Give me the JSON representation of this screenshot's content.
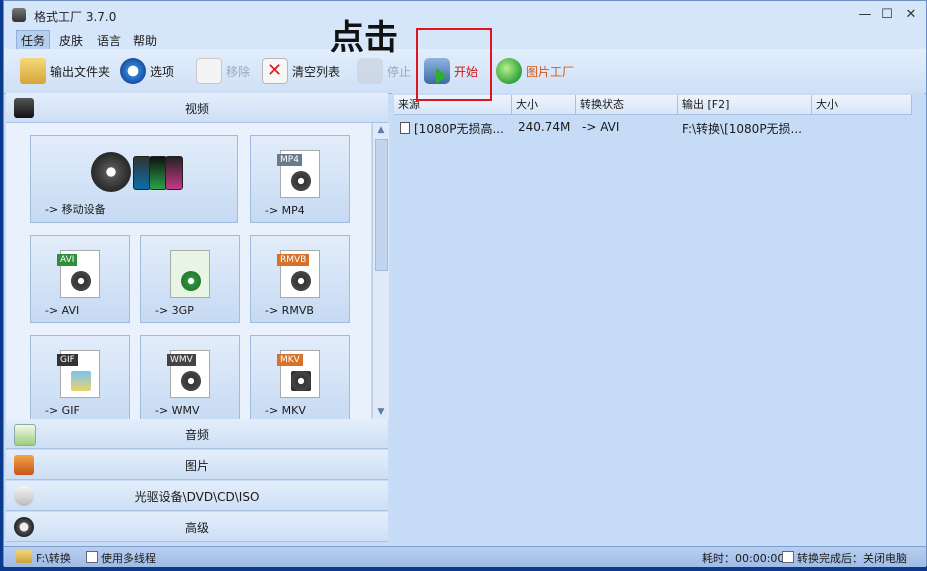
{
  "window": {
    "title": "格式工厂 3.7.0",
    "controls": {
      "minimize": "—",
      "maximize": "☐",
      "close": "✕"
    }
  },
  "menu": [
    "任务",
    "皮肤",
    "语言",
    "帮助"
  ],
  "toolbar": {
    "output_folder": "输出文件夹",
    "options": "选项",
    "remove": "移除",
    "clear_list": "清空列表",
    "stop": "停止",
    "start": "开始",
    "picture_factory": "图片工厂"
  },
  "annotation": "点击",
  "left_panel": {
    "video": "视频",
    "tiles": [
      {
        "label": "-> 移动设备",
        "tag": ""
      },
      {
        "label": "-> MP4",
        "tag": "MP4"
      },
      {
        "label": "-> AVI",
        "tag": "AVI"
      },
      {
        "label": "-> 3GP",
        "tag": "3GP"
      },
      {
        "label": "-> RMVB",
        "tag": "RMVB"
      },
      {
        "label": "-> GIF",
        "tag": "GIF"
      },
      {
        "label": "-> WMV",
        "tag": "WMV"
      },
      {
        "label": "-> MKV",
        "tag": "MKV"
      }
    ],
    "audio": "音频",
    "image": "图片",
    "disc": "光驱设备\\DVD\\CD\\ISO",
    "advanced": "高级"
  },
  "task_list": {
    "columns": [
      "来源",
      "大小",
      "转换状态",
      "输出 [F2]",
      "大小"
    ],
    "rows": [
      {
        "source": "[1080P无损高...",
        "size": "240.74M",
        "status": "-> AVI",
        "output": "F:\\转换\\[1080P无损...",
        "output_size": ""
      }
    ]
  },
  "status_bar": {
    "output_path": "F:\\转换",
    "multithread": "使用多线程",
    "elapsed": "耗时：00:00:00",
    "after_done": "转换完成后：关闭电脑"
  },
  "colors": {
    "highlight_box": "#e0141e",
    "start_text": "#d41414",
    "status_bar": "#a9c3ea"
  }
}
